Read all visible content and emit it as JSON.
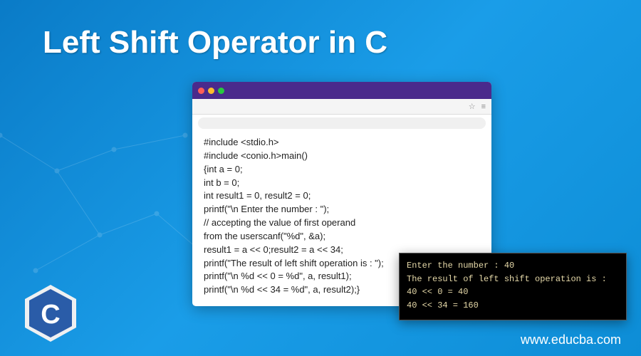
{
  "title": "Left Shift Operator in C",
  "site_url": "www.educba.com",
  "code_lines": [
    "#include <stdio.h>",
    "#include <conio.h>main()",
    "{int a = 0;",
    "int b = 0;",
    "int result1 = 0, result2 = 0;",
    "printf(\"\\n Enter the number : \");",
    "// accepting the value of first operand",
    "from the userscanf(\"%d\", &a);",
    "result1 = a << 0;result2 = a << 34;",
    "printf(\"The result of left shift operation is : \");",
    "printf(\"\\n %d << 0 = %d\", a, result1);",
    "printf(\"\\n %d << 34 = %d\", a, result2);}"
  ],
  "terminal_lines": [
    "Enter the number : 40",
    "The result of left shift operation is :",
    "40 << 0 = 40",
    "40 << 34 = 160"
  ],
  "logo_letter": "C"
}
